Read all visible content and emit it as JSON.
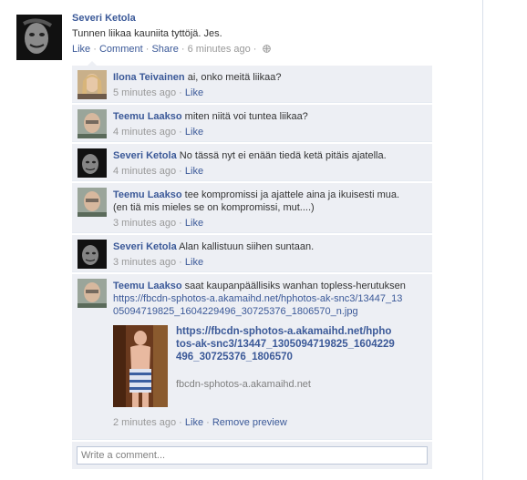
{
  "post": {
    "author": "Severi Ketola",
    "text": "Tunnen liikaa kauniita tyttöjä. Jes.",
    "actions": {
      "like": "Like",
      "comment": "Comment",
      "share": "Share"
    },
    "time": "6 minutes ago"
  },
  "comments": [
    {
      "author": "Ilona Teivainen",
      "text": "ai, onko meitä liikaa?",
      "time": "5 minutes ago",
      "like": "Like",
      "avatar": "female-photo"
    },
    {
      "author": "Teemu Laakso",
      "text": "miten niitä voi tuntea liikaa?",
      "time": "4 minutes ago",
      "like": "Like",
      "avatar": "male-photo"
    },
    {
      "author": "Severi Ketola",
      "text": "No tässä nyt ei enään tiedä ketä pitäis ajatella.",
      "time": "4 minutes ago",
      "like": "Like",
      "avatar": "dark-face-photo"
    },
    {
      "author": "Teemu Laakso",
      "text": "tee kompromissi ja ajattele aina ja ikuisesti mua.",
      "text2": "(en tiä mis mieles se on kompromissi, mut....)",
      "time": "3 minutes ago",
      "like": "Like",
      "avatar": "male-photo"
    },
    {
      "author": "Severi Ketola",
      "text": "Alan kallistuun siihen suntaan.",
      "time": "3 minutes ago",
      "like": "Like",
      "avatar": "dark-face-photo"
    },
    {
      "author": "Teemu Laakso",
      "text": "saat kaupanpäällisiks wanhan topless-herutuksen",
      "link": "https://fbcdn-sphotos-a.akamaihd.net/hphotos-ak-snc3/13447_1305094719825_1604229496_30725376_1806570_n.jpg",
      "preview": {
        "title": "https://fbcdn-sphotos-a.akamaihd.net/hphotos-ak-snc3/13447_1305094719825_1604229496_30725376_1806570",
        "domain": "fbcdn-sphotos-a.akamaihd.net"
      },
      "time": "2 minutes ago",
      "like": "Like",
      "remove_preview": "Remove preview",
      "avatar": "male-photo"
    }
  ],
  "write_comment": {
    "placeholder": "Write a comment..."
  },
  "colors": {
    "link": "#3b5998",
    "comment_bg": "#edeff4",
    "meta": "#999999"
  }
}
